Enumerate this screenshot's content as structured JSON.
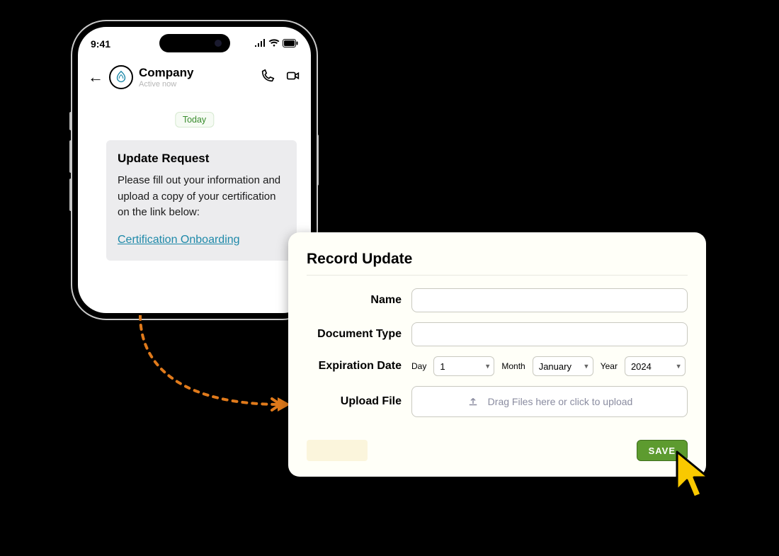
{
  "phone": {
    "clock": "9:41",
    "status_icons": [
      "signal-icon",
      "wifi-icon",
      "battery-icon"
    ],
    "chat": {
      "name": "Company",
      "status": "Active now",
      "today_chip": "Today"
    },
    "message": {
      "title": "Update Request",
      "body": "Please fill out your information and upload a copy of your certification on the link below:",
      "link_text": "Certification Onboarding"
    }
  },
  "form": {
    "title": "Record Update",
    "labels": {
      "name": "Name",
      "doc_type": "Document Type",
      "exp_date": "Expiration Date",
      "upload": "Upload File"
    },
    "date": {
      "day_label": "Day",
      "day_value": "1",
      "month_label": "Month",
      "month_value": "January",
      "year_label": "Year",
      "year_value": "2024"
    },
    "upload_hint": "Drag Files here or click to upload",
    "save_label": "SAVE"
  }
}
